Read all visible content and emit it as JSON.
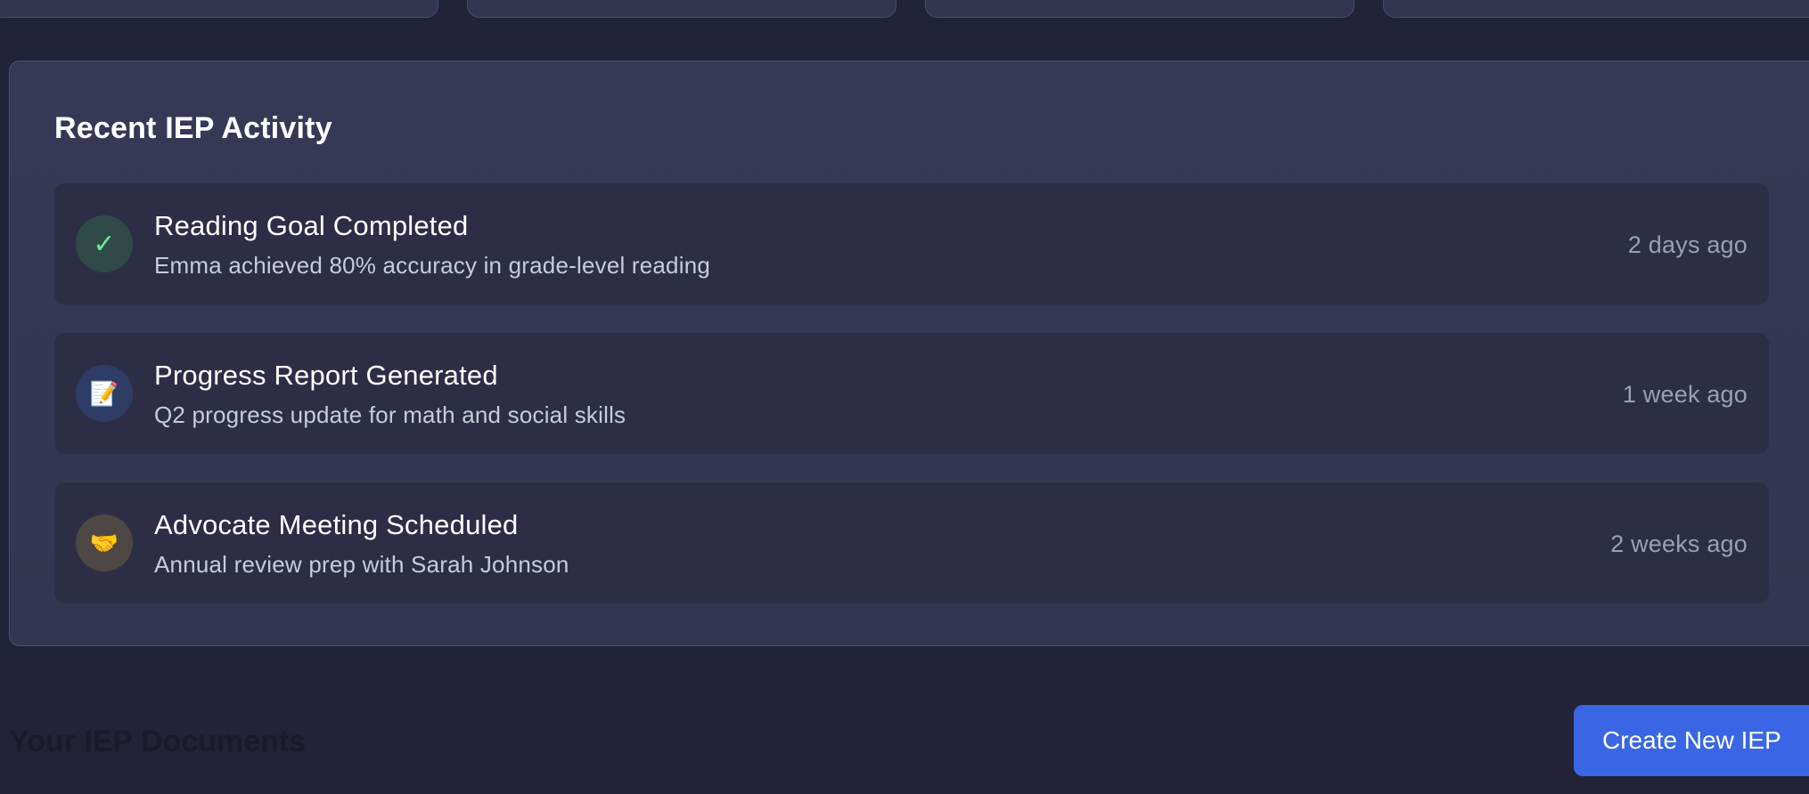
{
  "recent_activity": {
    "title": "Recent IEP Activity",
    "items": [
      {
        "icon": "check-icon",
        "glyph": "✓",
        "title": "Reading Goal Completed",
        "description": "Emma achieved 80% accuracy in grade-level reading",
        "time": "2 days ago"
      },
      {
        "icon": "memo-icon",
        "glyph": "📝",
        "title": "Progress Report Generated",
        "description": "Q2 progress update for math and social skills",
        "time": "1 week ago"
      },
      {
        "icon": "handshake-icon",
        "glyph": "🤝",
        "title": "Advocate Meeting Scheduled",
        "description": "Annual review prep with Sarah Johnson",
        "time": "2 weeks ago"
      }
    ]
  },
  "documents": {
    "title": "Your IEP Documents",
    "create_button_label": "Create New IEP"
  },
  "colors": {
    "background": "#222238",
    "panel": "#363754",
    "item": "#2d2e46",
    "accent_button": "#3a66e6",
    "success": "#6ee89a"
  }
}
